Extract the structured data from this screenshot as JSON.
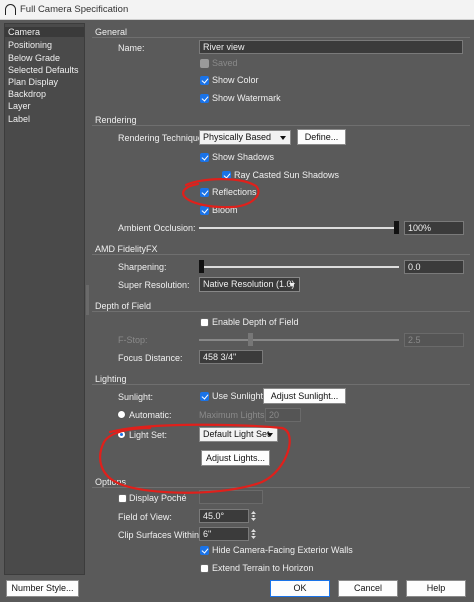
{
  "window": {
    "title": "Full Camera Specification"
  },
  "sidebar": {
    "items": [
      "Camera",
      "Positioning",
      "Below Grade",
      "Selected Defaults",
      "Plan Display",
      "Backdrop",
      "Layer",
      "Label"
    ]
  },
  "general": {
    "section_title": "General",
    "name_label": "Name:",
    "name_value": "River view",
    "saved_label": "Saved",
    "show_color_label": "Show Color",
    "show_watermark_label": "Show Watermark"
  },
  "rendering": {
    "section_title": "Rendering",
    "technique_label": "Rendering Technique:",
    "technique_value": "Physically Based",
    "define_button": "Define...",
    "show_shadows_label": "Show Shadows",
    "ray_casted_label": "Ray Casted Sun Shadows",
    "reflections_label": "Reflections",
    "bloom_label": "Bloom",
    "ambient_occlusion_label": "Ambient Occlusion:",
    "ambient_occlusion_value": "100%",
    "ambient_occlusion_level": 1.0
  },
  "fidelityfx": {
    "section_title": "AMD FidelityFX",
    "sharpening_label": "Sharpening:",
    "sharpening_value": "0.0",
    "sharpening_level": 0.0,
    "super_resolution_label": "Super Resolution:",
    "super_resolution_value": "Native Resolution (1.0)"
  },
  "depth_of_field": {
    "section_title": "Depth of Field",
    "enable_label": "Enable Depth of Field",
    "fstop_label": "F-Stop:",
    "fstop_value": "2.5",
    "focus_distance_label": "Focus Distance:",
    "focus_distance_value": "458 3/4\""
  },
  "lighting": {
    "section_title": "Lighting",
    "sunlight_label": "Sunlight:",
    "use_sunlight_label": "Use Sunlight",
    "adjust_sunlight_button": "Adjust Sunlight...",
    "automatic_label": "Automatic:",
    "max_lights_label": "Maximum Lights:",
    "max_lights_value": "20",
    "light_set_label": "Light Set:",
    "light_set_value": "Default Light Set",
    "adjust_lights_button": "Adjust Lights..."
  },
  "options": {
    "section_title": "Options",
    "display_poche_label": "Display Poché",
    "field_of_view_label": "Field of View:",
    "field_of_view_value": "45.0°",
    "clip_surfaces_label": "Clip Surfaces Within:",
    "clip_surfaces_value": "6\"",
    "hide_exterior_walls_label": "Hide Camera-Facing Exterior Walls",
    "extend_terrain_label": "Extend Terrain to Horizon"
  },
  "footer": {
    "number_style_button": "Number Style...",
    "ok_button": "OK",
    "cancel_button": "Cancel",
    "help_button": "Help"
  },
  "colors": {
    "accent": "#1a73e8",
    "annotation": "#e0201b",
    "background": "#5a5a5a"
  }
}
